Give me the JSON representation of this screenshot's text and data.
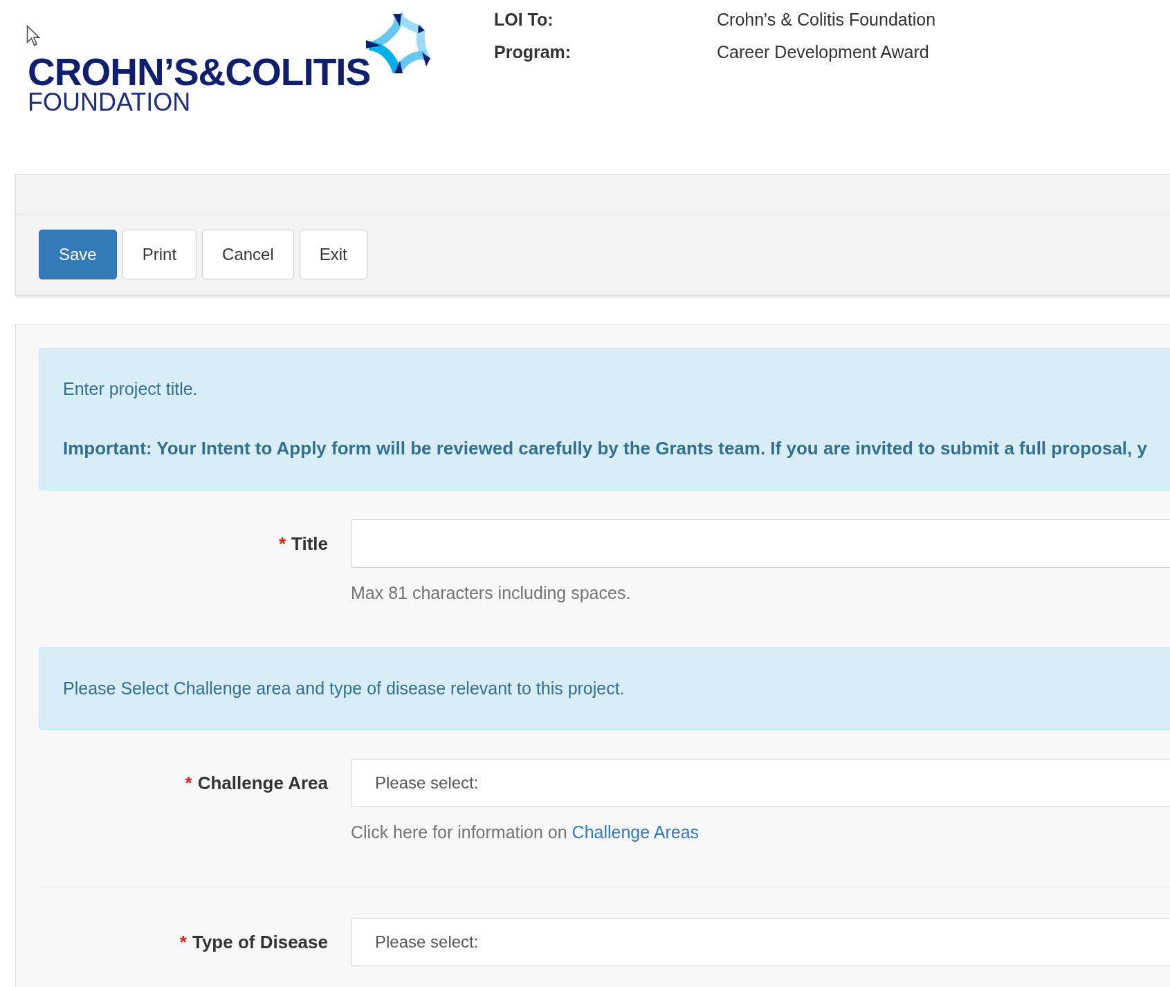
{
  "header": {
    "logo": {
      "name": "CROHN’S&COLITIS",
      "subtitle": "FOUNDATION"
    },
    "details": [
      {
        "label": "LOI To:",
        "value": "Crohn's & Colitis Foundation"
      },
      {
        "label": "Program:",
        "value": "Career Development Award"
      }
    ]
  },
  "toolbar": {
    "buttons": [
      {
        "label": "Save",
        "kind": "primary"
      },
      {
        "label": "Print",
        "kind": "default"
      },
      {
        "label": "Cancel",
        "kind": "default"
      },
      {
        "label": "Exit",
        "kind": "default"
      }
    ]
  },
  "form": {
    "sections": [
      {
        "kind": "info",
        "lines": [
          {
            "text": "Enter project title.",
            "bold": false
          },
          {
            "text": "Important: Your Intent to Apply form will be reviewed carefully by the Grants team. If you are invited to submit a full proposal, y",
            "bold": true
          }
        ]
      },
      {
        "kind": "text_field",
        "required_mark": "*",
        "label": "Title",
        "hint": "Max 81 characters including spaces."
      },
      {
        "kind": "info",
        "lines": [
          {
            "text": "Please Select Challenge area and type of disease relevant to this project.",
            "bold": false
          }
        ]
      },
      {
        "kind": "select_field",
        "required_mark": "*",
        "label": "Challenge Area",
        "value": "Please select:",
        "hint": "Click here for information on ",
        "hint_link": "Challenge Areas"
      },
      {
        "kind": "divider"
      },
      {
        "kind": "select_field",
        "required_mark": "*",
        "label": "Type of Disease",
        "value": "Please select:"
      }
    ]
  }
}
